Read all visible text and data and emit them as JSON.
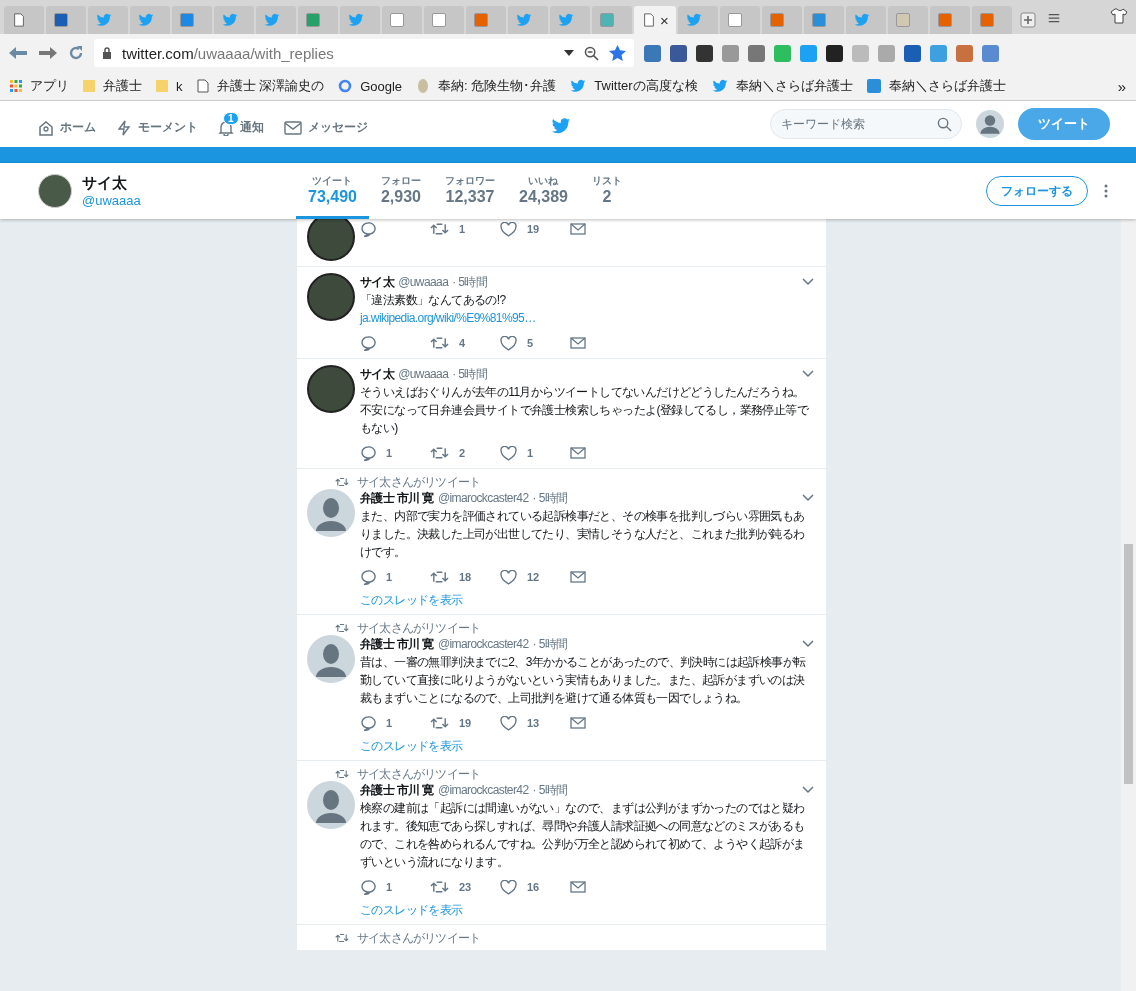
{
  "browser": {
    "tabs": [
      {
        "selected": false
      },
      {
        "selected": false
      },
      {
        "selected": false
      },
      {
        "selected": false
      },
      {
        "selected": false
      },
      {
        "selected": false
      },
      {
        "selected": false
      },
      {
        "selected": false
      },
      {
        "selected": false
      },
      {
        "selected": false
      },
      {
        "selected": false
      },
      {
        "selected": false
      },
      {
        "selected": false
      },
      {
        "selected": false
      },
      {
        "selected": false
      },
      {
        "selected": true,
        "close": "×"
      },
      {
        "selected": false
      },
      {
        "selected": false
      },
      {
        "selected": false
      },
      {
        "selected": false
      },
      {
        "selected": false
      },
      {
        "selected": false
      },
      {
        "selected": false
      },
      {
        "selected": false
      }
    ],
    "url": {
      "host": "twitter.com",
      "path": "/uwaaaa/with_replies"
    },
    "bookmarks": [
      "アプリ",
      "弁護士",
      "k",
      "弁護士 深澤諭史の",
      "Google",
      "奉納: 危険生物･弁護",
      "Twitterの高度な検",
      "奉納＼さらば弁護士",
      "奉納＼さらば弁護士"
    ],
    "more": "»"
  },
  "nav": {
    "items": [
      {
        "label": "ホーム"
      },
      {
        "label": "モーメント"
      },
      {
        "label": "通知",
        "badge": "1"
      },
      {
        "label": "メッセージ"
      }
    ],
    "search": {
      "placeholder": "キーワード検索"
    },
    "tweet_button": "ツイート"
  },
  "profile": {
    "name": "サイ太",
    "handle": "@uwaaaa",
    "stats": [
      {
        "label": "ツイート",
        "value": "73,490",
        "selected": true
      },
      {
        "label": "フォロー",
        "value": "2,930",
        "selected": false
      },
      {
        "label": "フォロワー",
        "value": "12,337",
        "selected": false
      },
      {
        "label": "いいね",
        "value": "24,389",
        "selected": false
      },
      {
        "label": "リスト",
        "value": "2",
        "selected": false
      }
    ],
    "follow_button": "フォローする"
  },
  "tweets": [
    {
      "kind": "own",
      "retweet": "1",
      "like": "19"
    },
    {
      "kind": "own",
      "name": "サイ太",
      "handle": "@uwaaaa",
      "time": "· 5時間",
      "text": "「違法素数」なんてあるの!?",
      "link": "ja.wikipedia.org/wiki/%E9%81%95…",
      "retweet": "4",
      "like": "5"
    },
    {
      "kind": "own",
      "name": "サイ太",
      "handle": "@uwaaaa",
      "time": "· 5時間",
      "text": "そういえばおぐりんが去年の11月からツイートしてないんだけどどうしたんだろうね。不安になって日弁連会員サイトで弁護士検索しちゃったよ(登録してるし，業務停止等でもない)",
      "reply": "1",
      "retweet": "2",
      "like": "1"
    },
    {
      "kind": "retweet",
      "retweeted_by": "サイ太さんがリツイート",
      "name": "弁護士 市川 寛",
      "handle": "@imarockcaster42",
      "time": "· 5時間",
      "text": "また、内部で実力を評価されている起訴検事だと、その検事を批判しづらい雰囲気もありました。決裁した上司が出世してたり、実情しそうな人だと、これまた批判が鈍るわけです。",
      "reply": "1",
      "retweet": "18",
      "like": "12",
      "thread": "このスレッドを表示"
    },
    {
      "kind": "retweet",
      "retweeted_by": "サイ太さんがリツイート",
      "name": "弁護士 市川 寛",
      "handle": "@imarockcaster42",
      "time": "· 5時間",
      "text": "昔は、一審の無罪判決までに2、3年かかることがあったので、判決時には起訴検事が転勤していて直接に叱りようがないという実情もありました。また、起訴がまずいのは決裁もまずいことになるので、上司批判を避けて通る体質も一因でしょうね。",
      "reply": "1",
      "retweet": "19",
      "like": "13",
      "thread": "このスレッドを表示"
    },
    {
      "kind": "retweet",
      "retweeted_by": "サイ太さんがリツイート",
      "name": "弁護士 市川 寛",
      "handle": "@imarockcaster42",
      "time": "· 5時間",
      "text": "検察の建前は「起訴には間違いがない」なので、まずは公判がまずかったのではと疑われます。後知恵であら探しすれば、尋問や弁護人請求証拠への同意などのミスがあるもので、これを咎められるんですね。公判が万全と認められて初めて、ようやく起訴がまずいという流れになります。",
      "reply": "1",
      "retweet": "23",
      "like": "16",
      "thread": "このスレッドを表示"
    },
    {
      "kind": "retweet",
      "retweeted_by": "サイ太さんがリツイート"
    }
  ]
}
